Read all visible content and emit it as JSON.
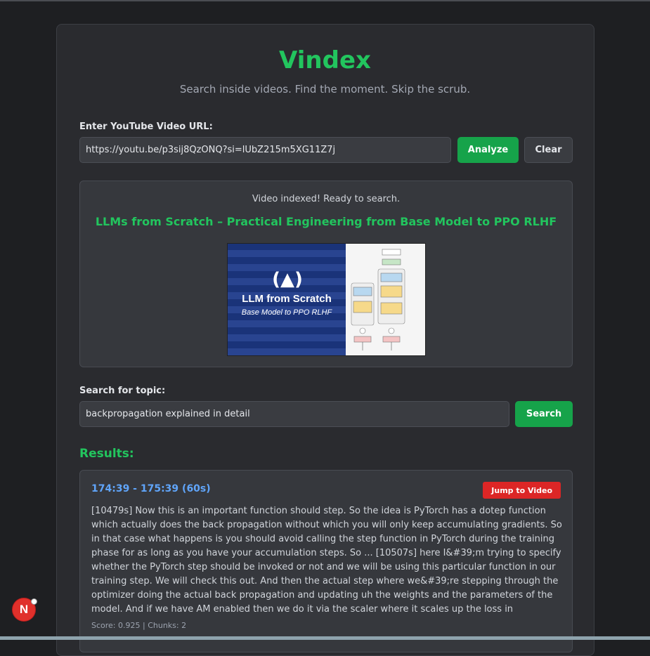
{
  "app": {
    "title": "Vindex",
    "tagline": "Search inside videos. Find the moment. Skip the scrub."
  },
  "url_section": {
    "label": "Enter YouTube Video URL:",
    "value": "https://youtu.be/p3sij8QzONQ?si=lUbZ215m5XG11Z7j",
    "analyze_label": "Analyze",
    "clear_label": "Clear"
  },
  "video": {
    "status": "Video indexed! Ready to search.",
    "title": "LLMs from Scratch – Practical Engineering from Base Model to PPO RLHF",
    "thumbnail_line1": "LLM from Scratch",
    "thumbnail_line2": "Base Model to PPO RLHF"
  },
  "search_section": {
    "label": "Search for topic:",
    "value": "backpropagation explained in detail",
    "search_label": "Search"
  },
  "results": {
    "heading": "Results:",
    "items": [
      {
        "time_range": "174:39 - 175:39 (60s)",
        "jump_label": "Jump to Video",
        "text": "[10479s] Now this is an important function should step. So the idea is PyTorch has a dotep function which actually does the back propagation without which you will only keep accumulating gradients. So in that case what happens is you should avoid calling the step function in PyTorch during the training phase for as long as you have your accumulation steps. So ... [10507s] here I&#39;m trying to specify whether the PyTorch step should be invoked or not and we will be using this particular function in our training step. We will check this out. And then the actual step where we&#39;re stepping through the optimizer doing the actual back propagation and updating uh the weights and the parameters of the model. And if we have AM enabled then we do it via the scaler where it scales up the loss in",
        "meta": "Score: 0.925 | Chunks: 2"
      }
    ]
  },
  "dev_badge": {
    "letter": "N"
  },
  "colors": {
    "accent": "#22c55e",
    "link": "#60a5fa",
    "danger": "#dc2626",
    "background": "#1e1f22",
    "card": "#2a2b2f"
  }
}
